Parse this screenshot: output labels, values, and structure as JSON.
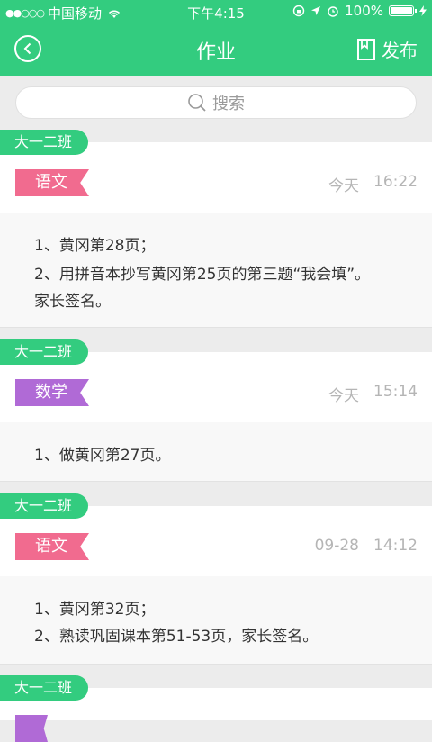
{
  "status_bar": {
    "signal": "●●○○○",
    "carrier": "中国移动",
    "time": "下午4:15",
    "battery_percent": "100%"
  },
  "navbar": {
    "title": "作业",
    "publish_label": "发布"
  },
  "search": {
    "placeholder": "搜索"
  },
  "homework": [
    {
      "class_name": "大一二班",
      "subject": "语文",
      "subject_color": "#f16b8f",
      "date": "今天",
      "time": "16:22",
      "lines": [
        "1、黄冈第28页；",
        "2、用拼音本抄写黄冈第25页的第三题“我会填”。",
        "家长签名。"
      ]
    },
    {
      "class_name": "大一二班",
      "subject": "数学",
      "subject_color": "#b06ad6",
      "date": "今天",
      "time": "15:14",
      "lines": [
        "1、做黄冈第27页。"
      ]
    },
    {
      "class_name": "大一二班",
      "subject": "语文",
      "subject_color": "#f16b8f",
      "date": "09-28",
      "time": "14:12",
      "lines": [
        "1、黄冈第32页；",
        "2、熟读巩固课本第51-53页，家长签名。"
      ]
    },
    {
      "class_name": "大一二班",
      "subject_color": "#b06ad6"
    }
  ],
  "colors": {
    "brand": "#33cc7f"
  }
}
